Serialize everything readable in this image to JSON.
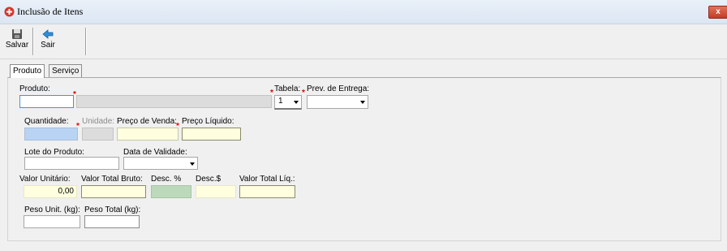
{
  "window": {
    "title": "Inclusão de Itens",
    "close_glyph": "x"
  },
  "toolbar": {
    "save_label": "Salvar",
    "exit_label": "Sair"
  },
  "tabs": [
    {
      "label": "Produto"
    },
    {
      "label": "Serviço"
    }
  ],
  "form": {
    "produto_label": "Produto:",
    "produto_value": "",
    "tabela_label": "Tabela:",
    "tabela_value": "1",
    "prev_entrega_label": "Prev. de Entrega:",
    "prev_entrega_value": "",
    "quantidade_label": "Quantidade:",
    "unidade_label": "Unidade:",
    "preco_venda_label": "Preço de Venda:",
    "preco_liquido_label": "Preço Líquido:",
    "lote_label": "Lote do Produto:",
    "validade_label": "Data de Validade:",
    "valor_unitario_label": "Valor Unitário:",
    "valor_unitario_value": "0,00",
    "valor_total_bruto_label": "Valor Total Bruto:",
    "desc_pct_label": "Desc. %",
    "desc_val_label": "Desc.$",
    "valor_total_liq_label": "Valor Total Líq.:",
    "peso_unit_label": "Peso Unit. (kg):",
    "peso_total_label": "Peso Total (kg):"
  },
  "colors": {
    "required_marker": "#e00000",
    "quantity_field": "#b8d3f3",
    "readonly_field": "#ffffe0",
    "discount_pct_field": "#bcd9bc"
  }
}
